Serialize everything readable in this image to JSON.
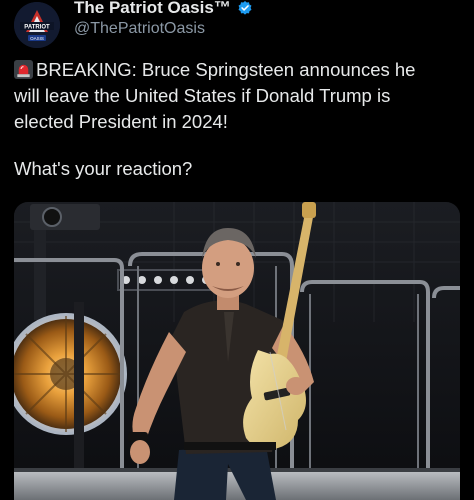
{
  "account": {
    "display_name": "The Patriot Oasis™",
    "handle": "@ThePatriotOasis",
    "avatar_text": "PATRIOT OASIS",
    "verified_icon": "verified-badge-icon",
    "badge_color": "#1d9bf0"
  },
  "tweet": {
    "lines": [
      "BREAKING: Bruce Springsteen announces he",
      "will leave the United States if Donald Trump is",
      "elected President in 2024!"
    ],
    "prefix_icon": "siren-icon",
    "reaction": "What's your reaction?"
  },
  "media": {
    "description_icon": "photo-musician-guitar"
  }
}
